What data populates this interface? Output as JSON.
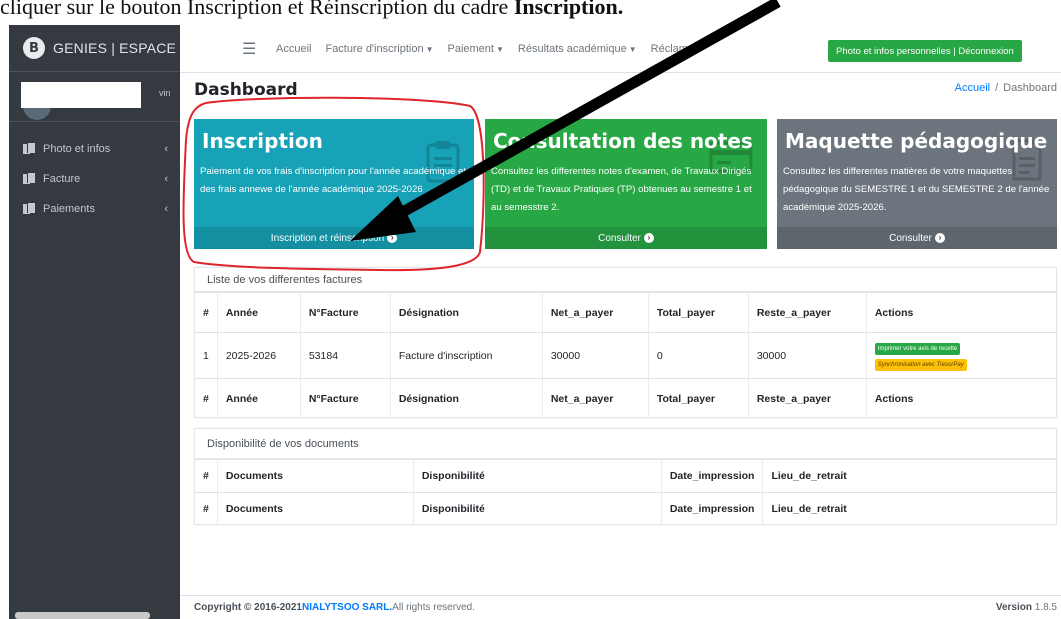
{
  "caption": {
    "prefix": "cliquer sur le bouton Inscription et Réinscription du cadre ",
    "bold": "Inscription."
  },
  "sidebar": {
    "brand_logo": "B",
    "brand": "GENIES | ESPACE ETUD",
    "user_name_suffix": "vin",
    "items": [
      {
        "label": "Photo et infos",
        "icon": "file-copy-icon"
      },
      {
        "label": "Facture",
        "icon": "file-copy-icon"
      },
      {
        "label": "Paiements",
        "icon": "file-copy-icon"
      }
    ]
  },
  "topbar": {
    "menu_icon": "bars-icon",
    "links": [
      {
        "label": "Accueil",
        "dropdown": false
      },
      {
        "label": "Facture d'inscription",
        "dropdown": true
      },
      {
        "label": "Paiement",
        "dropdown": true
      },
      {
        "label": "Résultats académique",
        "dropdown": true
      },
      {
        "label": "Réclam",
        "dropdown": false
      }
    ],
    "profile_button": "Photo et infos personnelles | Déconnexion"
  },
  "content": {
    "title": "Dashboard",
    "breadcrumb": {
      "home": "Accueil",
      "separator": "/",
      "current": "Dashboard"
    }
  },
  "boxes": [
    {
      "title": "Inscription",
      "text": "Paiement de vos frais d'inscription pour l'année académique et des frais annewe de l'année académique 2025-2026",
      "footer": "Inscription et réinscription",
      "color": "#17a2b8",
      "icon": "clipboard-icon"
    },
    {
      "title": "Consultation des notes",
      "text": "Consultez les differentes notes d'examen, de Travaux Dirigés (TD) et de Travaux Pratiques (TP) obtenues au semestre 1 et au semesstre 2.",
      "footer": "Consulter",
      "color": "#28a745",
      "icon": "card-icon"
    },
    {
      "title": "Maquette pédagogique",
      "text": "Consultez les differentes matières de votre maquettes pédagogique du SEMESTRE 1 et du SEMESTRE 2 de l'année académique 2025-2026.",
      "footer": "Consulter",
      "color": "#6c757d",
      "icon": "document-icon"
    }
  ],
  "invoices": {
    "title": "Liste de vos differentes factures",
    "headers": [
      "#",
      "Année",
      "N°Facture",
      "Désignation",
      "Net_a_payer",
      "Total_payer",
      "Reste_a_payer",
      "Actions"
    ],
    "rows": [
      {
        "num": "1",
        "annee": "2025-2026",
        "facture": "53184",
        "designation": "Facture d'inscription",
        "net": "30000",
        "total": "0",
        "reste": "30000",
        "action_print": "Imprimer votre avis de recette",
        "action_sync": "Synchronisation avec TresorPay"
      }
    ]
  },
  "documents": {
    "title": "Disponibilité de vos documents",
    "headers": [
      "#",
      "Documents",
      "Disponibilité",
      "Date_impression",
      "Lieu_de_retrait"
    ]
  },
  "footer": {
    "copyright": "Copyright © 2016-2021 ",
    "company": "NIALYTSOO SARL.",
    "rights": " All rights reserved.",
    "version_label": "Version",
    "version": " 1.8.5"
  },
  "colors": {
    "sidebar": "#343a40",
    "info": "#17a2b8",
    "success": "#28a745",
    "secondary": "#6c757d",
    "warning": "#ffc107",
    "link": "#007bff",
    "annotation": "#e0242b"
  }
}
